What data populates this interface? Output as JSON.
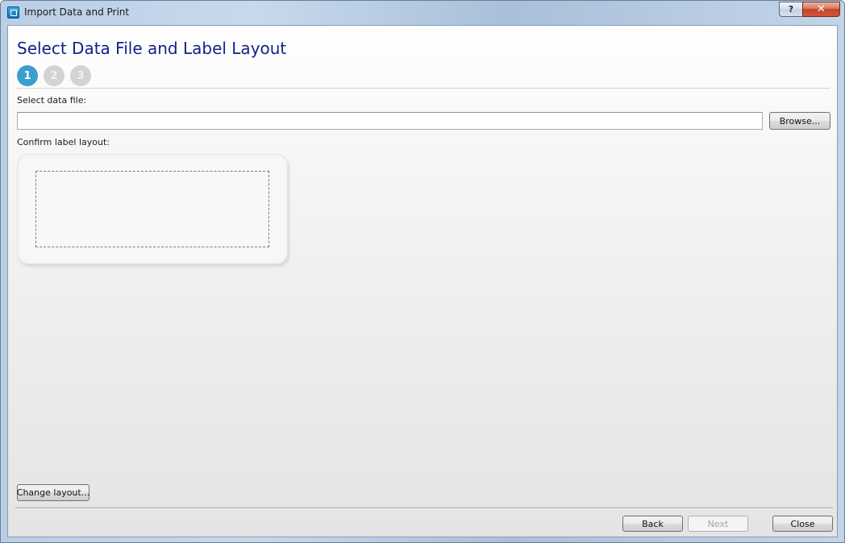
{
  "window": {
    "title": "Import Data and Print",
    "help_label": "?",
    "close_label": "✕"
  },
  "page": {
    "title": "Select Data File and Label Layout",
    "steps": [
      {
        "label": "1",
        "active": true
      },
      {
        "label": "2",
        "active": false
      },
      {
        "label": "3",
        "active": false
      }
    ]
  },
  "data_file": {
    "label": "Select data file:",
    "value": "",
    "browse_label": "Browse..."
  },
  "label_layout": {
    "label": "Confirm label layout:",
    "change_label": "Change layout..."
  },
  "footer": {
    "back_label": "Back",
    "next_label": "Next",
    "close_label": "Close"
  },
  "colors": {
    "title": "#13228a",
    "active_step": "#3a9ed1",
    "inactive_step": "#d3d3d3"
  },
  "icons": {
    "app": "label-printer-app-icon"
  }
}
